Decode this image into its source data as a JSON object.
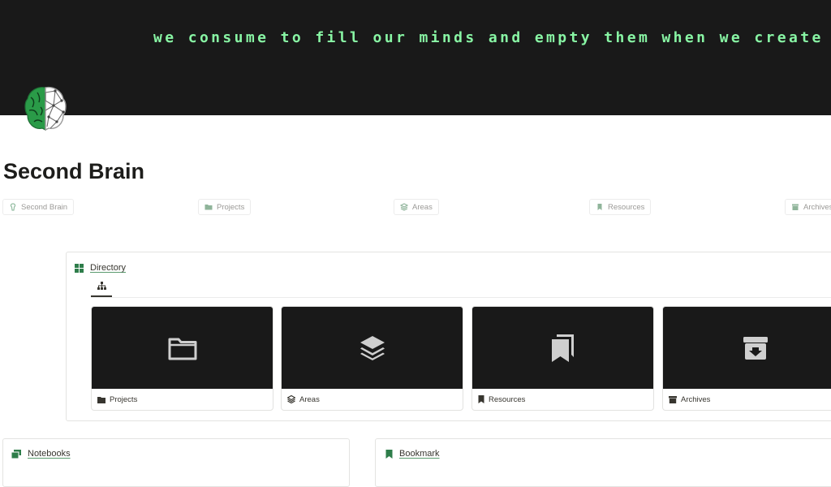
{
  "banner": {
    "quote": "we consume to fill our minds and empty them when we create"
  },
  "page": {
    "title": "Second Brain"
  },
  "nav": [
    {
      "label": "Second Brain",
      "icon": "brain-icon"
    },
    {
      "label": "Projects",
      "icon": "folder-icon"
    },
    {
      "label": "Areas",
      "icon": "layers-icon"
    },
    {
      "label": "Resources",
      "icon": "bookmark-icon"
    },
    {
      "label": "Archives",
      "icon": "archive-icon"
    }
  ],
  "directory": {
    "title": "Directory",
    "view_icon": "hierarchy-icon",
    "cards": [
      {
        "label": "Projects",
        "icon": "folder-icon"
      },
      {
        "label": "Areas",
        "icon": "layers-icon"
      },
      {
        "label": "Resources",
        "icon": "bookmarks-icon"
      },
      {
        "label": "Archives",
        "icon": "archive-icon"
      }
    ]
  },
  "notebooks": {
    "title": "Notebooks",
    "icon": "notebooks-icon"
  },
  "bookmark": {
    "title": "Bookmark",
    "icon": "bookmark-icon"
  },
  "colors": {
    "banner_bg": "#191919",
    "quote": "#88f5a4",
    "accent_green": "#2e7d4a"
  }
}
